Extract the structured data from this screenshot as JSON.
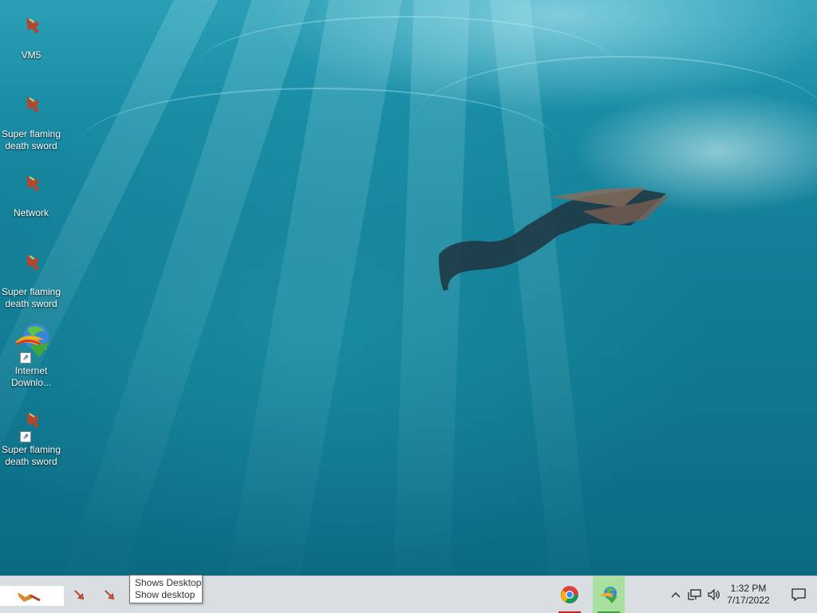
{
  "desktop": {
    "icons": [
      {
        "label": "VM5",
        "type": "sword"
      },
      {
        "label": "Super flaming death sword",
        "type": "sword"
      },
      {
        "label": "Network",
        "type": "sword"
      },
      {
        "label": "Super flaming death sword",
        "type": "sword"
      },
      {
        "label": "Internet Downlo...",
        "type": "idm",
        "shortcut": true
      },
      {
        "label": "Super flaming death sword",
        "type": "sword",
        "shortcut": true
      }
    ]
  },
  "taskbar": {
    "pinned_icons": [
      "sword-icon",
      "sword-icon"
    ],
    "tooltip": {
      "line1": "Shows Desktop",
      "line2": "Show desktop"
    },
    "running_apps": [
      {
        "name": "chrome-icon"
      },
      {
        "name": "idm-icon"
      }
    ],
    "tray_icons": [
      "chevron-up-icon",
      "network-icon",
      "volume-icon"
    ],
    "clock": {
      "time": "1:32 PM",
      "date": "7/17/2022"
    },
    "action_center_icon": "notification-icon"
  },
  "colors": {
    "taskbar_bg": "#d9dee3",
    "water_top": "#2a9fb6",
    "water_bottom": "#0c6a82",
    "chrome_indicator": "#d11f1f",
    "idm_indicator": "#3aa63a"
  }
}
